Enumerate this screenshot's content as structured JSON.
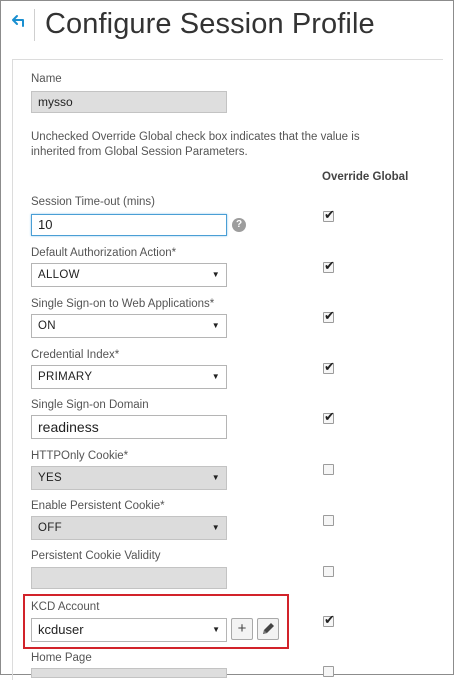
{
  "header": {
    "title": "Configure Session Profile",
    "back_icon": "back-arrow-icon"
  },
  "name": {
    "label": "Name",
    "value": "mysso"
  },
  "note": "Unchecked Override Global check box indicates that the value is inherited from Global Session Parameters.",
  "override_header": "Override Global",
  "fields": {
    "session_timeout": {
      "label": "Session Time-out (mins)",
      "value": "10",
      "help": "?"
    },
    "default_auth": {
      "label": "Default Authorization Action*",
      "value": "ALLOW"
    },
    "sso_web": {
      "label": "Single Sign-on to Web Applications*",
      "value": "ON"
    },
    "credential_index": {
      "label": "Credential Index*",
      "value": "PRIMARY"
    },
    "sso_domain": {
      "label": "Single Sign-on Domain",
      "value": "readiness"
    },
    "httponly_cookie": {
      "label": "HTTPOnly Cookie*",
      "value": "YES"
    },
    "persistent_cookie": {
      "label": "Enable Persistent Cookie*",
      "value": "OFF"
    },
    "persistent_validity": {
      "label": "Persistent Cookie Validity",
      "value": ""
    },
    "kcd_account": {
      "label": "KCD Account",
      "value": "kcduser",
      "add_icon": "plus-icon",
      "edit_icon": "pencil-icon"
    },
    "home_page": {
      "label": "Home Page"
    }
  },
  "override_checks": {
    "session_timeout": true,
    "default_auth": true,
    "sso_web": true,
    "credential_index": true,
    "sso_domain": true,
    "httponly_cookie": false,
    "persistent_cookie": false,
    "persistent_validity": false,
    "kcd_account": true,
    "home_page": false
  },
  "colors": {
    "highlight": "#d2232a",
    "back_icon": "#1a8fd0",
    "focus_border": "#4a9fd5"
  }
}
